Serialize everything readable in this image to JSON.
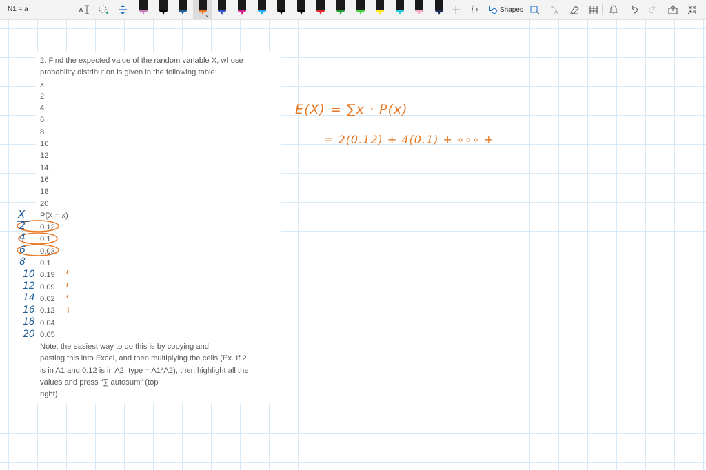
{
  "window": {
    "page_title": "N1 = a"
  },
  "toolbar": {
    "shapes_label": "Shapes",
    "pens": [
      {
        "color": "#c77dbb"
      },
      {
        "color": "#000000"
      },
      {
        "color": "#1f5d99"
      },
      {
        "color": "#e87722"
      },
      {
        "color": "#3355cc"
      },
      {
        "color": "#d61e8c"
      },
      {
        "color": "#22aaff"
      },
      {
        "color": "#000000"
      },
      {
        "color": "#000000"
      },
      {
        "color": "#e0282d"
      },
      {
        "color": "#21a03a"
      },
      {
        "color": "#45d63a"
      },
      {
        "color": "#ffe51a"
      },
      {
        "color": "#25c9e0"
      },
      {
        "color": "#f7a9c6"
      },
      {
        "color": "#1c2d5a"
      }
    ],
    "selected_pen_index": 3
  },
  "question": {
    "title_line1": "2. Find the expected value of the random variable X, whose",
    "title_line2": "probability distribution is given in the following table:",
    "x_header": "x",
    "x_values": [
      "2",
      "4",
      "6",
      "8",
      "10",
      "12",
      "14",
      "16",
      "18",
      "20"
    ],
    "p_header": "P(X = x)",
    "p_values": [
      "0.12",
      "0.1",
      "0.03",
      "0.1",
      "0.19",
      "0.09",
      "0.02",
      "0.12",
      "0.04",
      "0.05"
    ],
    "note_line1": "Note: the easiest way to do this is by copying and",
    "note_line2": "pasting this into Excel, and then multiplying the cells (Ex. If 2",
    "note_line3": "is in A1 and 0.12 is in A2, type = A1*A2), then highlight all the",
    "note_line4": "values and press “∑ autosum” (top",
    "note_line5": "right)."
  },
  "handwriting": {
    "left_column_header": "X",
    "left_column_values": [
      "2",
      "4",
      "6",
      "8",
      "10",
      "12",
      "14",
      "16",
      "18",
      "20"
    ],
    "formula_line1": "E(X) = ∑x · P(x)",
    "formula_line2": "= 2(0.12) + 4(0.1) + ∘∘∘ +"
  },
  "colors": {
    "ink_blue": "#1f5d99",
    "ink_orange": "#e87722",
    "grid": "#d6e9f6",
    "toolbar_bg": "#f3f3f3"
  }
}
